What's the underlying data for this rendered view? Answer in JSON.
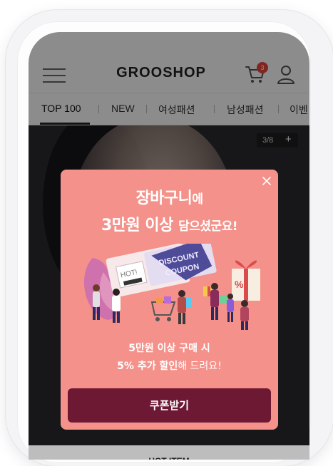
{
  "header": {
    "logo": "GROOSHOP",
    "cart_count": "3"
  },
  "tabs": [
    {
      "label": "TOP 100"
    },
    {
      "label": "NEW"
    },
    {
      "label": "여성패션"
    },
    {
      "label": "남성패션"
    },
    {
      "label": "이벤"
    }
  ],
  "hero": {
    "counter": "3/8",
    "counter_add": "+",
    "bottom_label": "HOT ITEM"
  },
  "popup": {
    "title_line1_main": "장바구니",
    "title_line1_suffix": "에",
    "title_line2_main": "3만원 이상",
    "title_line2_suffix": "담으셨군요!",
    "illustration": {
      "coupon_text_1": "DISCOUNT",
      "coupon_text_2": "COUPON",
      "hot_text": "HOT!"
    },
    "desc_line1": "5만원 이상 구매 시",
    "desc_line2_strong": "5% 추가 할인",
    "desc_line2_rest": "해 드려요!",
    "button_label": "쿠폰받기"
  },
  "colors": {
    "popup_bg": "#f4918a",
    "button_bg": "#6d1934",
    "badge": "#e8463a"
  }
}
